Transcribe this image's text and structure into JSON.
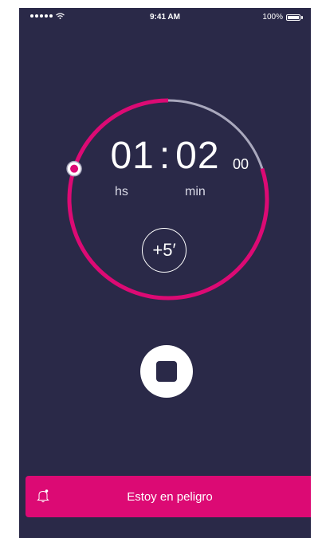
{
  "status_bar": {
    "signal_icon": "signal-dots",
    "wifi_icon": "wifi-icon",
    "time": "9:41 AM",
    "battery_percent": "100%",
    "battery_level": 1.0
  },
  "timer": {
    "hours": "01",
    "separator": ":",
    "minutes": "02",
    "seconds": "00",
    "hours_label": "hs",
    "minutes_label": "min",
    "progress_fraction": 0.8,
    "add_button_label": "+5′"
  },
  "controls": {
    "stop_icon": "stop-icon"
  },
  "danger": {
    "label": "Estoy en peligro",
    "icon": "bell-icon"
  },
  "colors": {
    "background": "#2a2948",
    "accent": "#dc0a74",
    "track": "#a9a8bd",
    "white": "#ffffff"
  }
}
